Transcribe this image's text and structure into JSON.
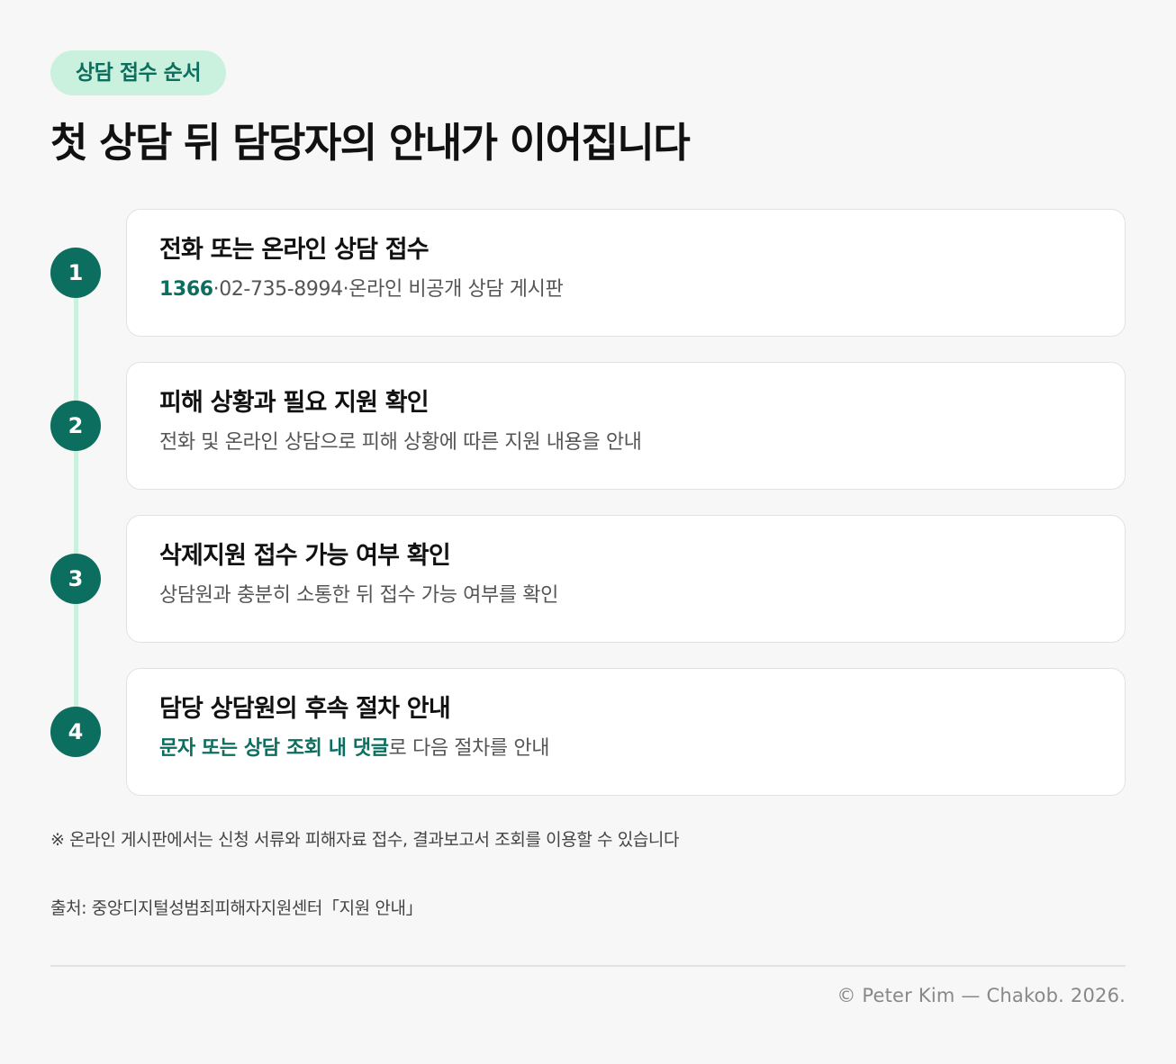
{
  "badge": "상담 접수 순서",
  "title": "첫 상담 뒤 담당자의 안내가 이어집니다",
  "steps": [
    {
      "number": "1",
      "title": "전화 또는 온라인 상담 접수",
      "desc_highlight": "1366",
      "desc_rest": "·02-735-8994·온라인 비공개 상담 게시판"
    },
    {
      "number": "2",
      "title": "피해 상황과 필요 지원 확인",
      "desc_highlight": "",
      "desc_rest": "전화 및 온라인 상담으로 피해 상황에 따른 지원 내용을 안내"
    },
    {
      "number": "3",
      "title": "삭제지원 접수 가능 여부 확인",
      "desc_highlight": "",
      "desc_rest": "상담원과 충분히 소통한 뒤 접수 가능 여부를 확인"
    },
    {
      "number": "4",
      "title": "담당 상담원의 후속 절차 안내",
      "desc_highlight": "문자 또는 상담 조회 내 댓글",
      "desc_rest": "로 다음 절차를 안내"
    }
  ],
  "note": "※ 온라인 게시판에서는 신청 서류와 피해자료 접수, 결과보고서 조회를 이용할 수 있습니다",
  "source": "출처: 중앙디지털성범죄피해자지원센터「지원 안내」",
  "copyright": "© Peter Kim — Chakob. 2026.",
  "colors": {
    "accent": "#0c6e5e",
    "accent_light": "#c9f1dd",
    "background": "#f7f7f7"
  }
}
